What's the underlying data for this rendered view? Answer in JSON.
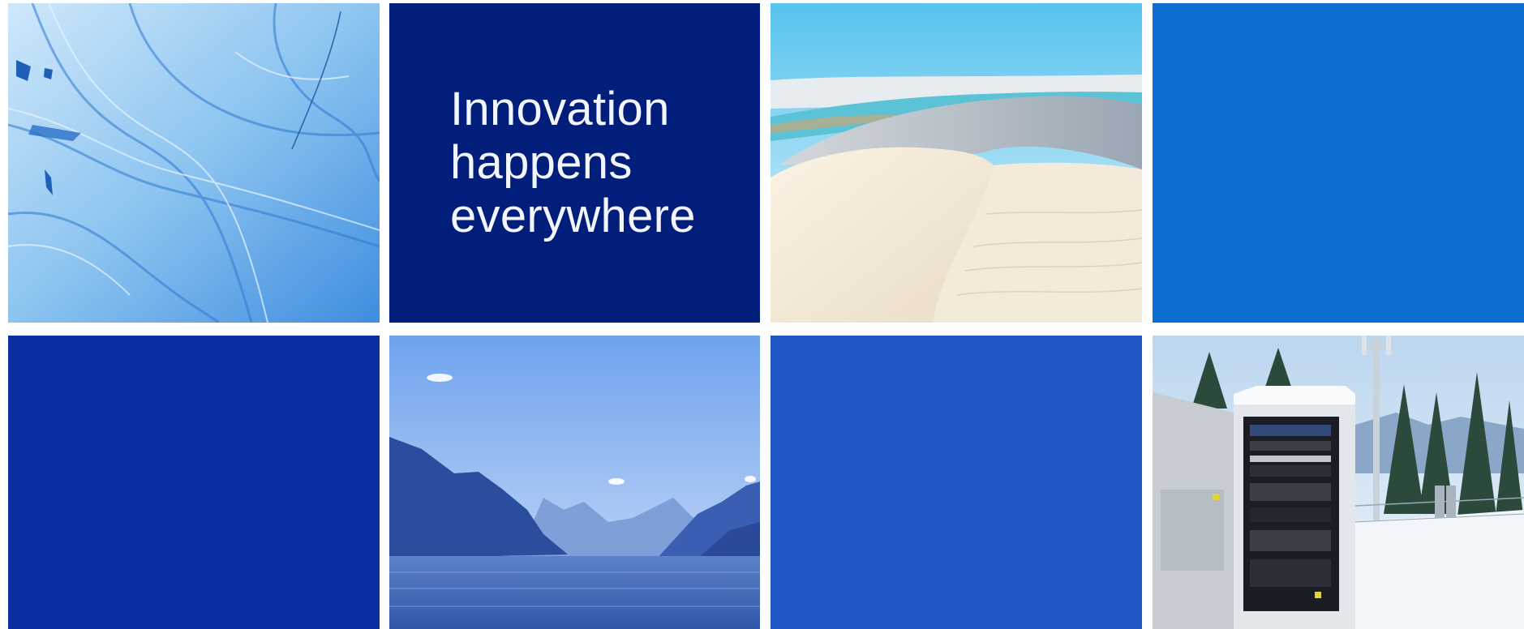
{
  "hero": {
    "headline_lines": [
      "Innovation",
      "happens",
      "everywhere"
    ]
  },
  "tiles": [
    {
      "id": "relief-map",
      "kind": "image",
      "icon": "relief-map-photo"
    },
    {
      "id": "headline",
      "kind": "text",
      "color": "#001e7a"
    },
    {
      "id": "sand-dunes",
      "kind": "image",
      "icon": "sand-dunes-photo"
    },
    {
      "id": "solid-azure",
      "kind": "color",
      "color": "#0a6fd0"
    },
    {
      "id": "solid-royal",
      "kind": "color",
      "color": "#0a2da0"
    },
    {
      "id": "mountain-lake",
      "kind": "image",
      "icon": "mountain-lake-photo"
    },
    {
      "id": "solid-cobalt",
      "kind": "color",
      "color": "#1f56c4"
    },
    {
      "id": "telecom-cabinet",
      "kind": "image",
      "icon": "telecom-cabinet-photo"
    }
  ]
}
